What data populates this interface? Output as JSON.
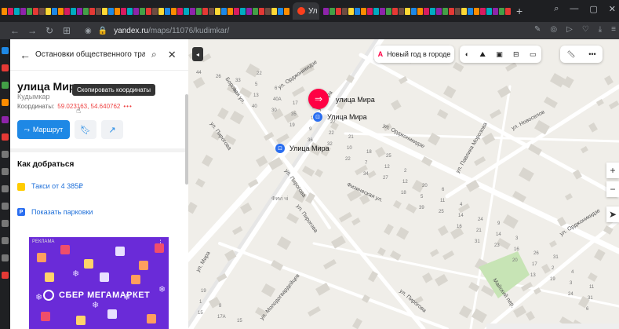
{
  "browser": {
    "active_tab_label": "Ул",
    "url_host": "yandex.ru",
    "url_path": "/maps/11076/kudimkar/"
  },
  "search": {
    "value": "Остановки общественного трансп"
  },
  "place": {
    "title": "улица Мира",
    "subtitle": "Кудымкар",
    "coords_label": "Координаты:",
    "coords_value": "59.023163, 54.640762",
    "coords_more": "•••",
    "tooltip": "Скопировать координаты"
  },
  "actions": {
    "route_label": "Маршрут"
  },
  "how_to_get": {
    "title": "Как добраться",
    "taxi_label": "Такси от 4 385₽",
    "parking_label": "Показать парковки"
  },
  "ad": {
    "label": "РЕКЛАМА",
    "brand": "СБЕР МЕГАМАРКЕТ"
  },
  "map": {
    "new_year_chip": "Новый год в городе",
    "pin_label": "улица Мира",
    "stop1": "Улица Мира",
    "stop2": "Улица Мира",
    "poi_label": "Фиvi чi",
    "streets": {
      "s1": "ул. Орджоникидзе",
      "s2": "Боровая ул.",
      "s3": "ул. Орджоникидзе",
      "s4": "ул. Пирогова",
      "s5": "ул. Новоселов",
      "s6": "ул. Павлика Морозова",
      "s7": "ул. Пирогова",
      "s8": "Физическая ул.",
      "s9": "ул. Пирогова",
      "s10": "ул. Орджоникидзе",
      "s11": "ул. Мира",
      "s12": "ул. Мира",
      "s13": "ул. Молодогвардейцев",
      "s14": "ул. Пирогова",
      "s15": "Майский пер."
    },
    "house_numbers": [
      "44",
      "40",
      "36",
      "34",
      "39",
      "31",
      "13",
      "6",
      "8",
      "19",
      "22",
      "18",
      "16",
      "20",
      "24",
      "26",
      "30",
      "32",
      "27",
      "25",
      "23",
      "19",
      "15",
      "13",
      "9",
      "7",
      "5",
      "21",
      "17",
      "31",
      "33",
      "35",
      "10",
      "12",
      "14",
      "16",
      "3",
      "17A",
      "40А",
      "22",
      "12",
      "11",
      "14",
      "2",
      "1",
      "5",
      "14",
      "18",
      "20",
      "24",
      "26",
      "11",
      "15",
      "17",
      "21",
      "2",
      "4",
      "3",
      "4",
      "8",
      "6",
      "27",
      "25",
      "6",
      "9",
      "31",
      "19",
      "22",
      "25"
    ]
  },
  "colors": {
    "accent": "#1e88e5",
    "pin": "#ff0044",
    "map_bg": "#f0eee9",
    "ad_bg": "#6a2bd8"
  }
}
